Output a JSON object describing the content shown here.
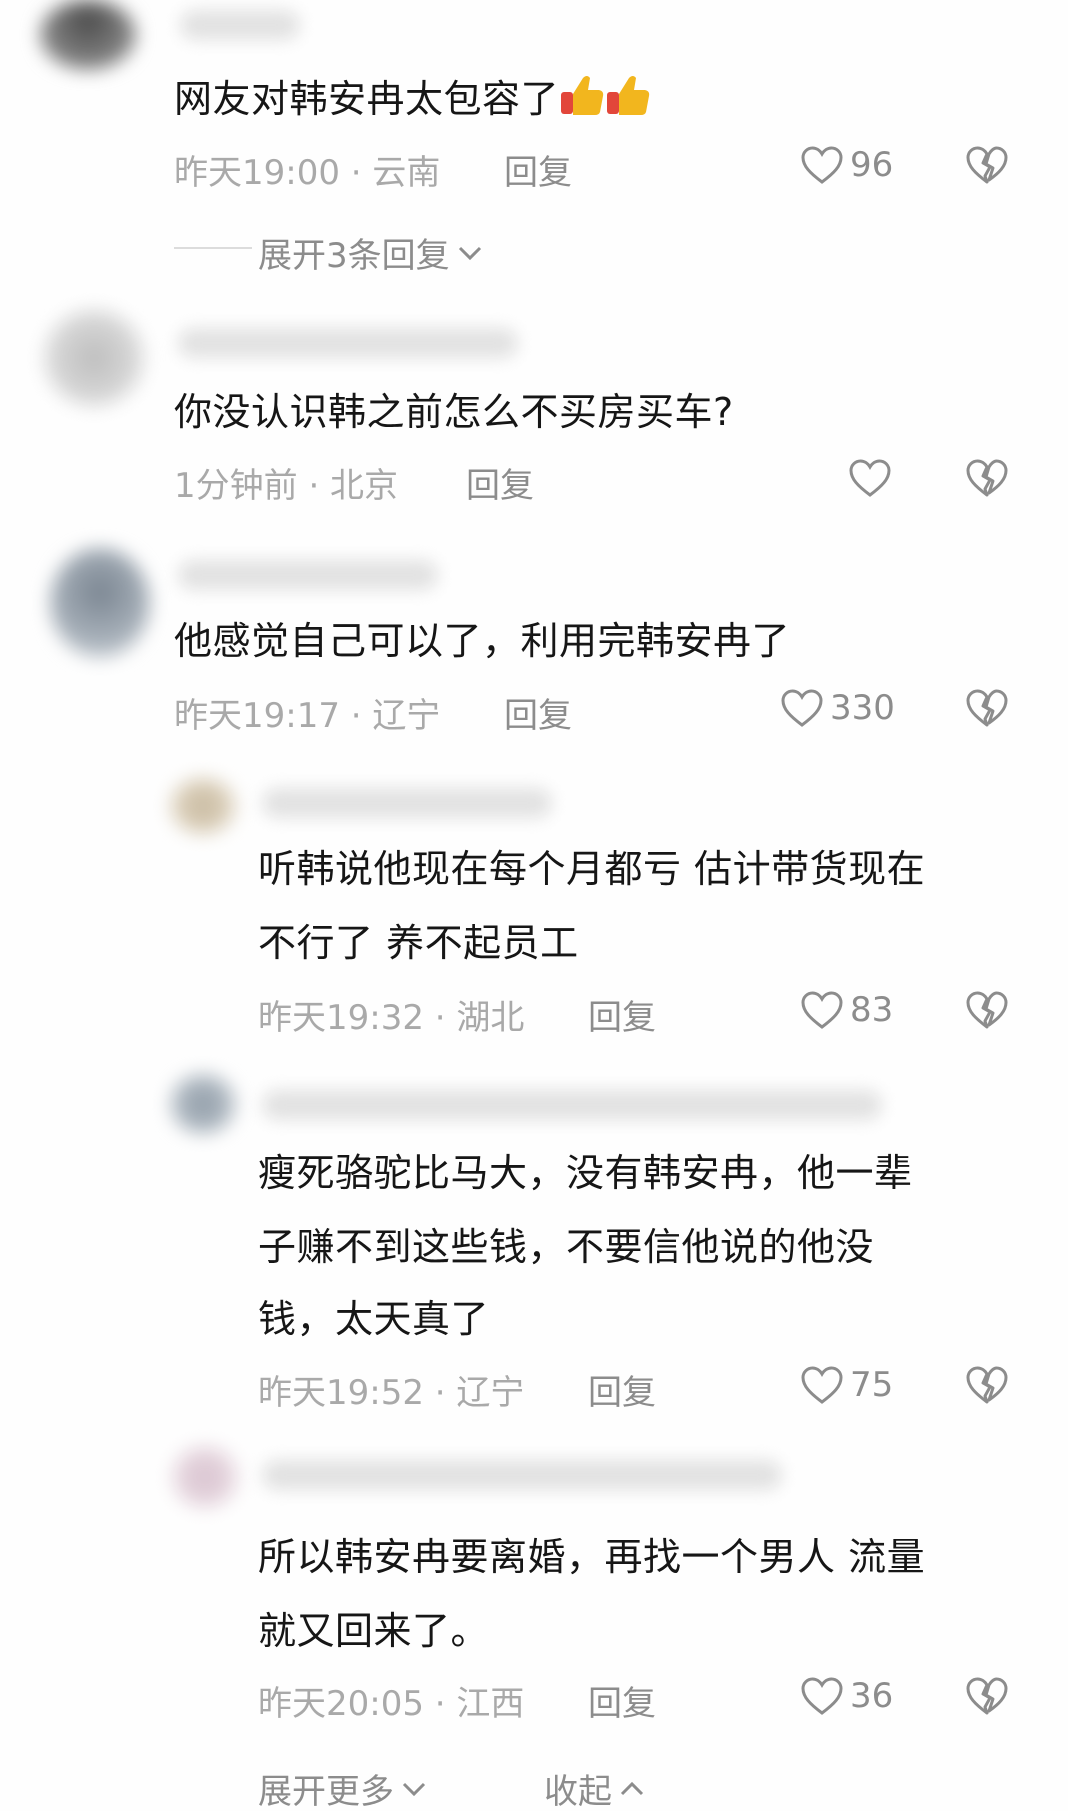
{
  "colors": {
    "background": "#fefefe",
    "text": "#161616",
    "meta": "#a9a9a9",
    "action": "#8c8c8c",
    "thumb": "#f2b61e",
    "thumb_cuff": "#e2463a"
  },
  "comments": [
    {
      "text": "网友对韩安冉太包容了",
      "emoji": "thumbs-up x2",
      "meta": "昨天19:00 · 云南",
      "reply_label": "回复",
      "likes": "96",
      "expand_label": "展开3条回复"
    },
    {
      "text": "你没认识韩之前怎么不买房买车?",
      "meta": "1分钟前 · 北京",
      "reply_label": "回复",
      "likes": ""
    },
    {
      "text": "他感觉自己可以了，利用完韩安冉了",
      "meta": "昨天19:17 · 辽宁",
      "reply_label": "回复",
      "likes": "330"
    }
  ],
  "replies": [
    {
      "lines": [
        "听韩说他现在每个月都亏 估计带货现在",
        "不行了  养不起员工"
      ],
      "meta": "昨天19:32 · 湖北",
      "reply_label": "回复",
      "likes": "83"
    },
    {
      "lines": [
        "瘦死骆驼比马大，没有韩安冉，他一辈",
        "子赚不到这些钱，不要信他说的他没",
        "钱，太天真了"
      ],
      "meta": "昨天19:52 · 辽宁",
      "reply_label": "回复",
      "likes": "75"
    },
    {
      "lines": [
        "所以韩安冉要离婚，再找一个男人 流量",
        "就又回来了。"
      ],
      "meta": "昨天20:05 · 江西",
      "reply_label": "回复",
      "likes": "36"
    }
  ],
  "footer": {
    "expand_more_label": "展开更多",
    "collapse_label": "收起"
  }
}
